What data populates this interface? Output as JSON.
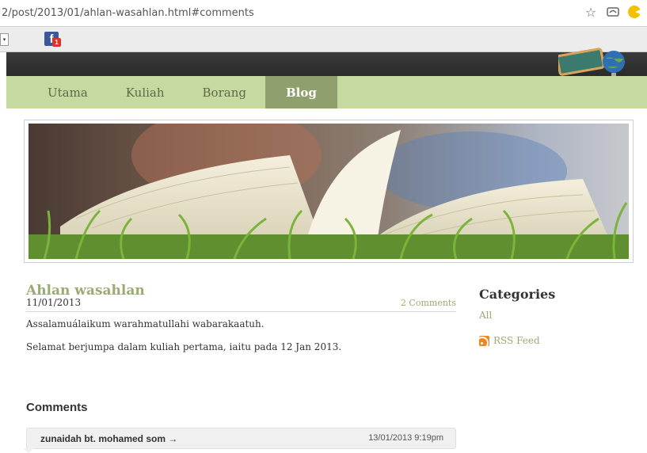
{
  "browser": {
    "url": "2/post/2013/01/ahlan-wasahlan.html#comments",
    "star_icon": "star-icon",
    "cloud_icon": "cloud-icon",
    "extension_icon": "pacman-icon",
    "bookmark_badge": "1",
    "bookmark_letter": "f"
  },
  "nav": {
    "items": [
      {
        "label": "Utama"
      },
      {
        "label": "Kuliah"
      },
      {
        "label": "Borang"
      },
      {
        "label": "Blog",
        "active": true
      }
    ]
  },
  "post": {
    "title": "Ahlan wasahlan",
    "date": "11/01/2013",
    "comments_link": "2 Comments",
    "paragraphs": [
      "Assalamuálaikum warahmatullahi wabarakaatuh.",
      "Selamat berjumpa dalam kuliah pertama, iaitu pada 12 Jan 2013."
    ]
  },
  "sidebar": {
    "categories_title": "Categories",
    "categories": [
      "All"
    ],
    "rss_label": "RSS Feed"
  },
  "comments": {
    "heading": "Comments",
    "items": [
      {
        "author": "zunaidah bt. mohamed som →",
        "date": "13/01/2013 9:19pm"
      }
    ]
  },
  "colors": {
    "nav_bg": "#c5d9a0",
    "nav_active": "#8fa06e",
    "link": "#9aab72",
    "header_bg": "#2e2e2e"
  }
}
